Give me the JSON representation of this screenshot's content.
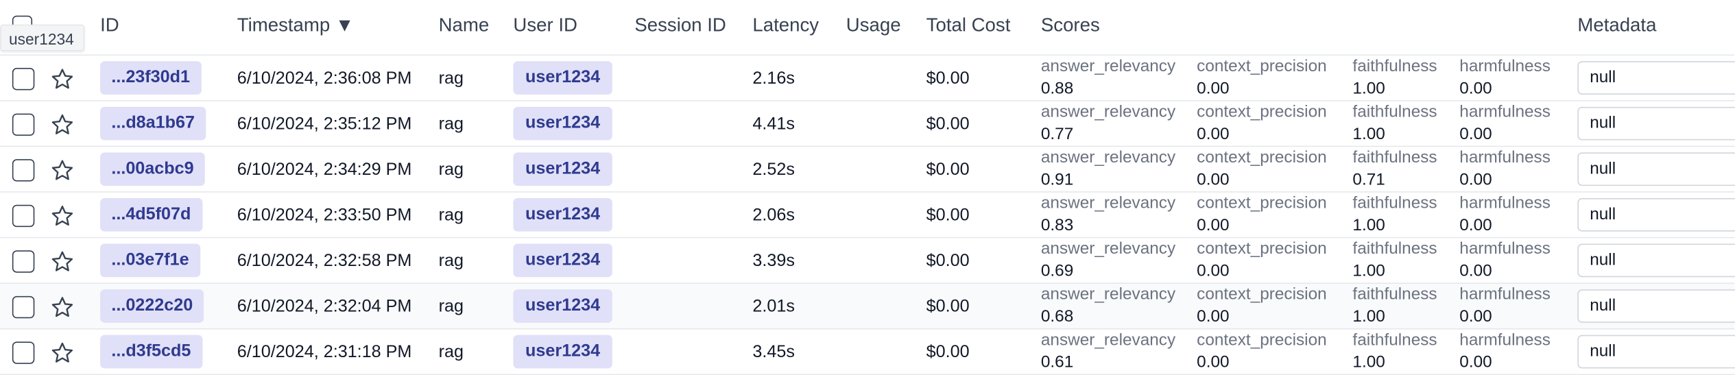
{
  "tooltip": "user1234",
  "columns": {
    "id": "ID",
    "timestamp": "Timestamp ▼",
    "name": "Name",
    "user_id": "User ID",
    "session_id": "Session ID",
    "latency": "Latency",
    "usage": "Usage",
    "total_cost": "Total Cost",
    "scores": "Scores",
    "metadata": "Metadata"
  },
  "score_names": {
    "answer_relevancy": "answer_relevancy",
    "context_precision": "context_precision",
    "faithfulness": "faithfulness",
    "harmfulness": "harmfulness"
  },
  "rows": [
    {
      "id": "...23f30d1",
      "timestamp": "6/10/2024, 2:36:08 PM",
      "name": "rag",
      "user": "user1234",
      "session": "",
      "latency": "2.16s",
      "usage": "",
      "cost": "$0.00",
      "answer_relevancy": "0.88",
      "context_precision": "0.00",
      "faithfulness": "1.00",
      "harmfulness": "0.00",
      "metadata": "null"
    },
    {
      "id": "...d8a1b67",
      "timestamp": "6/10/2024, 2:35:12 PM",
      "name": "rag",
      "user": "user1234",
      "session": "",
      "latency": "4.41s",
      "usage": "",
      "cost": "$0.00",
      "answer_relevancy": "0.77",
      "context_precision": "0.00",
      "faithfulness": "1.00",
      "harmfulness": "0.00",
      "metadata": "null"
    },
    {
      "id": "...00acbc9",
      "timestamp": "6/10/2024, 2:34:29 PM",
      "name": "rag",
      "user": "user1234",
      "session": "",
      "latency": "2.52s",
      "usage": "",
      "cost": "$0.00",
      "answer_relevancy": "0.91",
      "context_precision": "0.00",
      "faithfulness": "0.71",
      "harmfulness": "0.00",
      "metadata": "null"
    },
    {
      "id": "...4d5f07d",
      "timestamp": "6/10/2024, 2:33:50 PM",
      "name": "rag",
      "user": "user1234",
      "session": "",
      "latency": "2.06s",
      "usage": "",
      "cost": "$0.00",
      "answer_relevancy": "0.83",
      "context_precision": "0.00",
      "faithfulness": "1.00",
      "harmfulness": "0.00",
      "metadata": "null"
    },
    {
      "id": "...03e7f1e",
      "timestamp": "6/10/2024, 2:32:58 PM",
      "name": "rag",
      "user": "user1234",
      "session": "",
      "latency": "3.39s",
      "usage": "",
      "cost": "$0.00",
      "answer_relevancy": "0.69",
      "context_precision": "0.00",
      "faithfulness": "1.00",
      "harmfulness": "0.00",
      "metadata": "null"
    },
    {
      "id": "...0222c20",
      "timestamp": "6/10/2024, 2:32:04 PM",
      "name": "rag",
      "user": "user1234",
      "session": "",
      "latency": "2.01s",
      "usage": "",
      "cost": "$0.00",
      "answer_relevancy": "0.68",
      "context_precision": "0.00",
      "faithfulness": "1.00",
      "harmfulness": "0.00",
      "metadata": "null"
    },
    {
      "id": "...d3f5cd5",
      "timestamp": "6/10/2024, 2:31:18 PM",
      "name": "rag",
      "user": "user1234",
      "session": "",
      "latency": "3.45s",
      "usage": "",
      "cost": "$0.00",
      "answer_relevancy": "0.61",
      "context_precision": "0.00",
      "faithfulness": "1.00",
      "harmfulness": "0.00",
      "metadata": "null"
    }
  ]
}
